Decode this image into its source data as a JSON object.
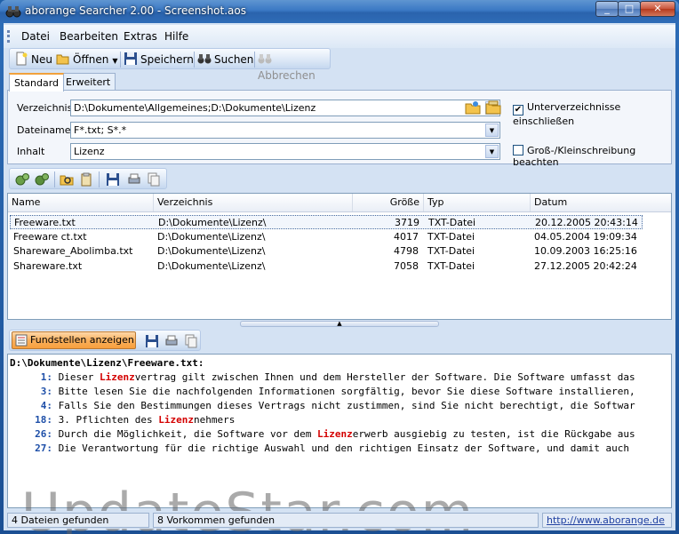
{
  "window": {
    "title": "aborange Searcher 2.00 - Screenshot.aos",
    "min": "_",
    "max": "□",
    "close": "✕"
  },
  "menu": {
    "items": [
      "Datei",
      "Bearbeiten",
      "Extras",
      "Hilfe"
    ]
  },
  "toolbar": {
    "neu": "Neu",
    "oeffnen": "Öffnen",
    "speichern": "Speichern",
    "suchen": "Suchen",
    "abbrechen": "Abbrechen"
  },
  "tabs": [
    "Standard",
    "Erweitert"
  ],
  "search": {
    "verzeichnis_label": "Verzeichnis",
    "verzeichnis_value": "D:\\Dokumente\\Allgemeines;D:\\Dokumente\\Lizenz",
    "dateiname_label": "Dateiname",
    "dateiname_value": "F*.txt; S*.*",
    "inhalt_label": "Inhalt",
    "inhalt_value": "Lizenz",
    "subdirs_label": "Unterverzeichnisse einschließen",
    "subdirs_checked": true,
    "case_label": "Groß-/Kleinschreibung beachten",
    "case_checked": false
  },
  "results": {
    "columns": [
      "Name",
      "Verzeichnis",
      "Größe",
      "Typ",
      "Datum"
    ],
    "rows": [
      {
        "name": "Freeware.txt",
        "dir": "D:\\Dokumente\\Lizenz\\",
        "size": "3719",
        "type": "TXT-Datei",
        "date": "20.12.2005 20:43:14"
      },
      {
        "name": "Freeware ct.txt",
        "dir": "D:\\Dokumente\\Lizenz\\",
        "size": "4017",
        "type": "TXT-Datei",
        "date": "04.05.2004 19:09:34"
      },
      {
        "name": "Shareware_Abolimba.txt",
        "dir": "D:\\Dokumente\\Lizenz\\",
        "size": "4798",
        "type": "TXT-Datei",
        "date": "10.09.2003 16:25:16"
      },
      {
        "name": "Shareware.txt",
        "dir": "D:\\Dokumente\\Lizenz\\",
        "size": "7058",
        "type": "TXT-Datei",
        "date": "27.12.2005 20:42:24"
      }
    ]
  },
  "fundstellen": {
    "label": "Fundstellen anzeigen"
  },
  "preview": {
    "path": "D:\\Dokumente\\Lizenz\\Freeware.txt:",
    "lines": [
      {
        "num": "1:",
        "pre": "Dieser ",
        "hl": "Lizenz",
        "post": "vertrag gilt zwischen Ihnen und dem Hersteller der Software. Die Software umfasst das"
      },
      {
        "num": "3:",
        "pre": "Bitte lesen Sie die nachfolgenden Informationen sorgfältig, bevor Sie diese Software installieren,",
        "hl": "",
        "post": ""
      },
      {
        "num": "4:",
        "pre": "Falls Sie den Bestimmungen dieses Vertrags nicht zustimmen, sind Sie nicht berechtigt, die Softwar",
        "hl": "",
        "post": ""
      },
      {
        "num": "18:",
        "pre": "3. Pflichten des ",
        "hl": "Lizenz",
        "post": "nehmers"
      },
      {
        "num": "26:",
        "pre": "Durch die Möglichkeit, die Software vor dem ",
        "hl": "Lizenz",
        "post": "erwerb ausgiebig zu testen, ist die Rückgabe aus"
      },
      {
        "num": "27:",
        "pre": "Die Verantwortung für die richtige Auswahl und den richtigen Einsatz der Software, und damit auch",
        "hl": "",
        "post": ""
      }
    ]
  },
  "watermark": "UpdateStar.com",
  "status": {
    "files": "4 Dateien gefunden",
    "matches": "8 Vorkommen gefunden",
    "url": "http://www.aborange.de"
  }
}
